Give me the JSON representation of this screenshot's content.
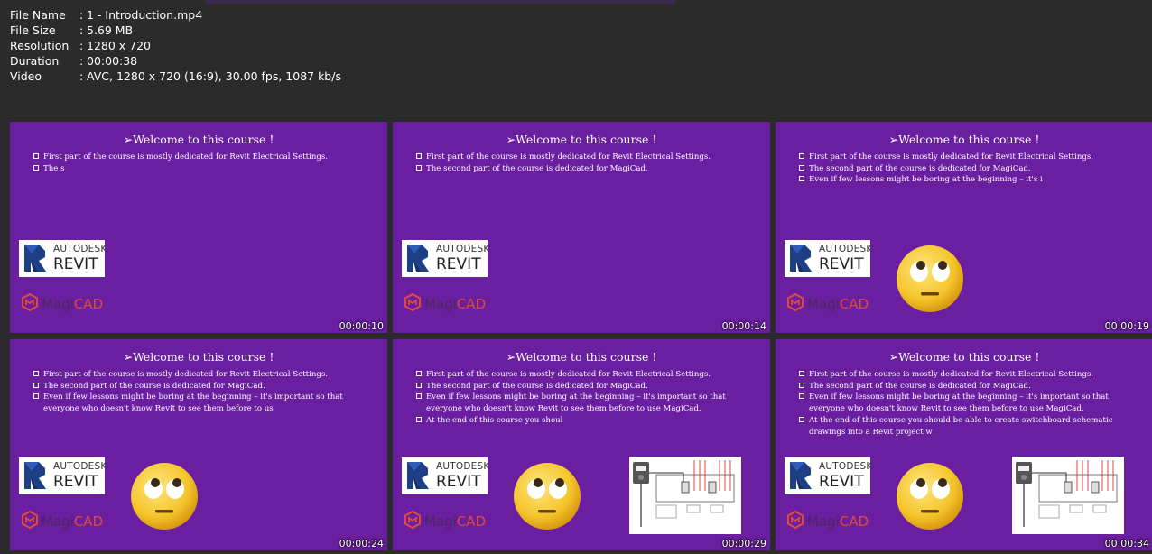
{
  "file_info": {
    "rows": [
      {
        "key": "File Name",
        "value": "1 - Introduction.mp4"
      },
      {
        "key": "File Size",
        "value": "5.69 MB"
      },
      {
        "key": "Resolution",
        "value": "1280 x 720"
      },
      {
        "key": "Duration",
        "value": "00:00:38"
      },
      {
        "key": "Video",
        "value": "AVC, 1280 x 720 (16:9), 30.00 fps, 1087 kb/s"
      }
    ],
    "separator": ":"
  },
  "slide": {
    "title": "➢Welcome to this course !",
    "revit_brand": "AUTODESK",
    "revit_name": "REVIT",
    "magicad_a": "Magi",
    "magicad_b": "CAD"
  },
  "thumbnails": [
    {
      "timestamp": "00:00:10",
      "bullets": [
        "First part of the course is mostly dedicated for Revit Electrical Settings.",
        "The s"
      ],
      "emoji": false,
      "diagram": false
    },
    {
      "timestamp": "00:00:14",
      "bullets": [
        "First part of the course is mostly dedicated for Revit Electrical Settings.",
        "The second part of the course is dedicated for MagiCad."
      ],
      "emoji": false,
      "diagram": false
    },
    {
      "timestamp": "00:00:19",
      "bullets": [
        "First part of the course is mostly dedicated for Revit Electrical Settings.",
        "The second part of the course is dedicated for MagiCad.",
        "Even if few lessons might be boring at the beginning – it's i"
      ],
      "emoji": true,
      "diagram": false
    },
    {
      "timestamp": "00:00:24",
      "bullets": [
        "First part of the course is mostly dedicated for Revit Electrical Settings.",
        "The second part of the course is dedicated for MagiCad.",
        "Even if few lessons might be boring at the beginning – it's important so that everyone who doesn't know Revit to see them before to us"
      ],
      "emoji": true,
      "diagram": false
    },
    {
      "timestamp": "00:00:29",
      "bullets": [
        "First part of the course is mostly dedicated for Revit Electrical Settings.",
        "The second part of the course is dedicated for MagiCad.",
        "Even if few lessons might be boring at the beginning – it's important so that everyone who doesn't know Revit to see them before to use MagiCad.",
        "At the end of this course you shoul"
      ],
      "emoji": true,
      "diagram": true
    },
    {
      "timestamp": "00:00:34",
      "bullets": [
        "First part of the course is mostly dedicated for Revit Electrical Settings.",
        "The second part of the course is dedicated for MagiCad.",
        "Even if few lessons might be boring at the beginning – it's important so that everyone who doesn't know Revit to see them before to use MagiCad.",
        "At the end of this course you should be able to create switchboard schematic drawings into a Revit project w"
      ],
      "emoji": true,
      "diagram": true
    }
  ],
  "colors": {
    "background": "#2b2b2b",
    "slide_purple": "#6a1ea0",
    "magicad_red": "#e04a3a"
  }
}
